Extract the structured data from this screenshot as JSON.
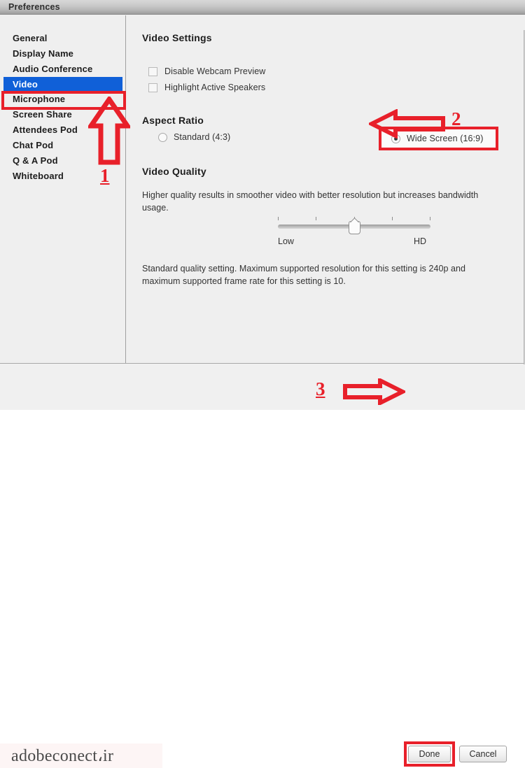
{
  "window": {
    "title": "Preferences"
  },
  "sidebar": {
    "items": [
      {
        "label": "General",
        "selected": false
      },
      {
        "label": "Display Name",
        "selected": false
      },
      {
        "label": "Audio Conference",
        "selected": false
      },
      {
        "label": "Video",
        "selected": true
      },
      {
        "label": "Microphone",
        "selected": false
      },
      {
        "label": "Screen Share",
        "selected": false
      },
      {
        "label": "Attendees Pod",
        "selected": false
      },
      {
        "label": "Chat Pod",
        "selected": false
      },
      {
        "label": "Q & A Pod",
        "selected": false
      },
      {
        "label": "Whiteboard",
        "selected": false
      }
    ]
  },
  "panel": {
    "video_settings": {
      "title": "Video Settings",
      "checkboxes": [
        {
          "label": "Disable Webcam Preview",
          "checked": false
        },
        {
          "label": "Highlight Active Speakers",
          "checked": false
        }
      ]
    },
    "aspect_ratio": {
      "title": "Aspect Ratio",
      "options": [
        {
          "label": "Standard (4:3)",
          "selected": false
        },
        {
          "label": "Wide Screen (16:9)",
          "selected": true
        }
      ]
    },
    "video_quality": {
      "title": "Video Quality",
      "description": "Higher quality results in smoother video with better resolution but increases bandwidth usage.",
      "slider": {
        "min_label": "Low",
        "max_label": "HD",
        "ticks": 5,
        "position": 3
      },
      "status": "Standard quality setting. Maximum supported resolution for this setting is 240p and maximum supported frame rate for this setting is 10."
    }
  },
  "footer": {
    "done_label": "Done",
    "cancel_label": "Cancel",
    "watermark": "adobeconect،ir"
  },
  "annotations": {
    "step1": {
      "number": "1",
      "icon": "arrow-up-icon"
    },
    "step2": {
      "number": "2",
      "icon": "arrow-left-icon"
    },
    "step3": {
      "number": "3",
      "icon": "arrow-right-icon"
    }
  },
  "colors": {
    "accent_red": "#e8202a",
    "selection_blue": "#1060d8"
  }
}
